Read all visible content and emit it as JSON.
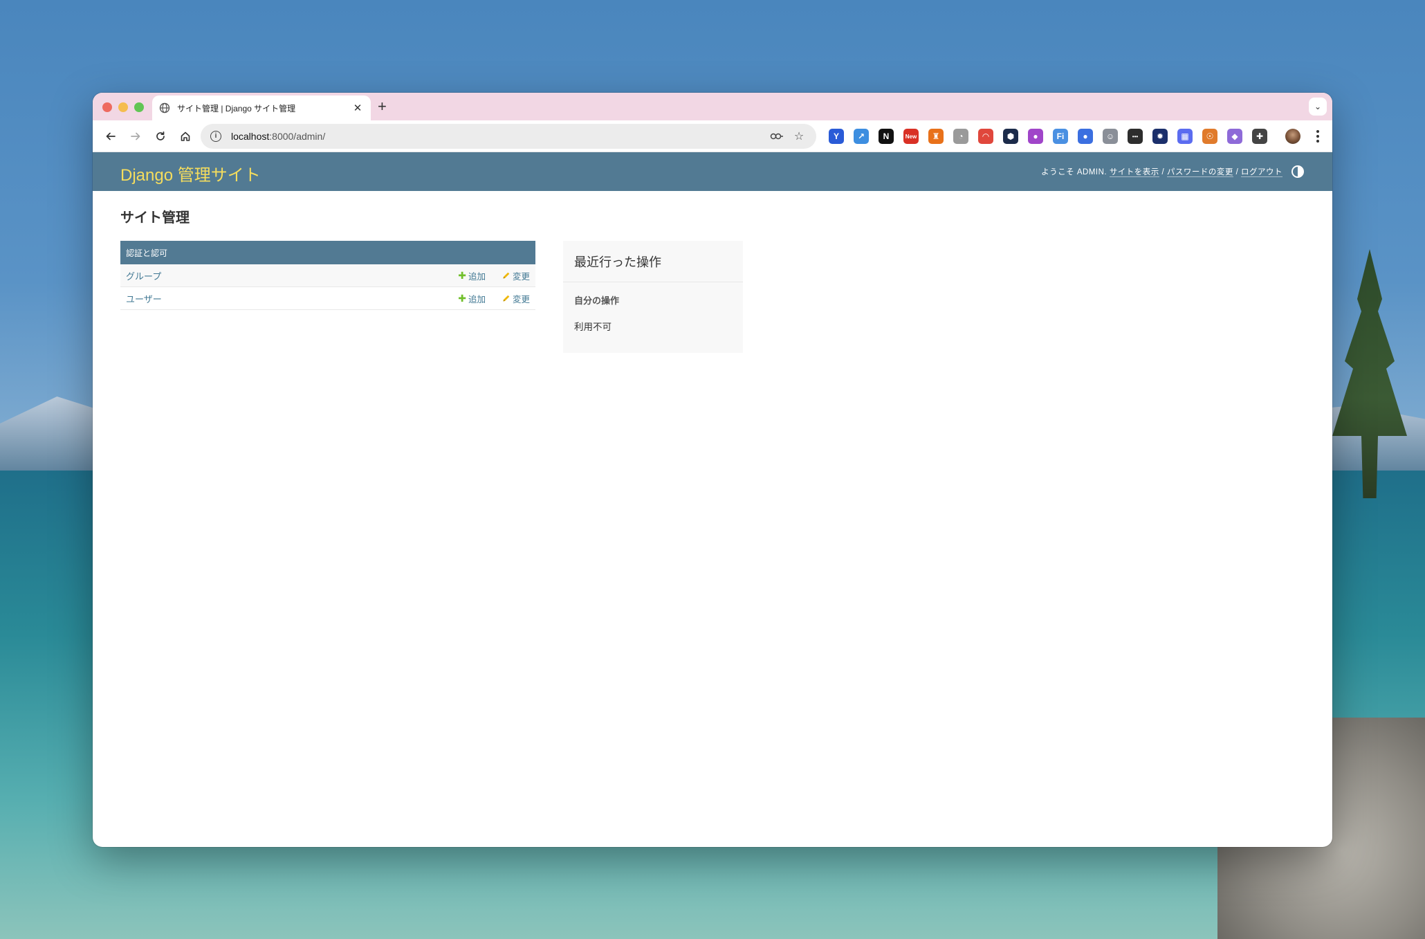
{
  "browser": {
    "tab_title": "サイト管理 | Django サイト管理",
    "new_tab_label": "+",
    "url_host": "localhost",
    "url_path": ":8000/admin/",
    "extensions": [
      {
        "icon": "v-logo-icon",
        "color": "#2a5bd7",
        "glyph": "Y"
      },
      {
        "icon": "share-icon",
        "color": "#3d8ee0",
        "glyph": "↗"
      },
      {
        "icon": "notion-icon",
        "color": "#111111",
        "glyph": "N"
      },
      {
        "icon": "new-badge-icon",
        "color": "#d93025",
        "glyph": "New"
      },
      {
        "icon": "fox-icon",
        "color": "#e8711a",
        "glyph": "♜"
      },
      {
        "icon": "rss-icon",
        "color": "#9a9a9a",
        "glyph": "◔"
      },
      {
        "icon": "red-swirl-icon",
        "color": "#e0473c",
        "glyph": "◠"
      },
      {
        "icon": "hexagon-icon",
        "color": "#1c2b4a",
        "glyph": "⬢"
      },
      {
        "icon": "purple-square-icon",
        "color": "#a045c9",
        "glyph": "●"
      },
      {
        "icon": "fi-icon",
        "color": "#4a90e2",
        "glyph": "Fi"
      },
      {
        "icon": "blue-dot-icon",
        "color": "#3b6fe0",
        "glyph": "●"
      },
      {
        "icon": "robot-icon",
        "color": "#8a8f98",
        "glyph": "☺"
      },
      {
        "icon": "dots-square-icon",
        "color": "#2d2d2d",
        "glyph": "•••"
      },
      {
        "icon": "sunburst-icon",
        "color": "#1b2f6b",
        "glyph": "✹"
      },
      {
        "icon": "grid-icon",
        "color": "#5b6cf0",
        "glyph": "▦"
      },
      {
        "icon": "snail-icon",
        "color": "#e07b2c",
        "glyph": "☉"
      },
      {
        "icon": "crystal-icon",
        "color": "#8e6ad8",
        "glyph": "◆"
      },
      {
        "icon": "puzzle-icon",
        "color": "#444444",
        "glyph": "✚"
      }
    ]
  },
  "admin": {
    "brand": "Django 管理サイト",
    "user_tools": {
      "welcome": "ようこそ ADMIN.",
      "view_site": "サイトを表示",
      "sep1": " / ",
      "change_password": "パスワードの変更",
      "sep2": " / ",
      "logout": "ログアウト"
    },
    "page_title": "サイト管理",
    "module": {
      "caption": "認証と認可",
      "rows": [
        {
          "name": "グループ",
          "add": "追加",
          "change": "変更"
        },
        {
          "name": "ユーザー",
          "add": "追加",
          "change": "変更"
        }
      ]
    },
    "recent": {
      "title": "最近行った操作",
      "subtitle": "自分の操作",
      "empty": "利用不可"
    }
  },
  "colors": {
    "header": "#527a93",
    "brand": "#f5dd5d",
    "link": "#417893",
    "add_icon": "#70bf2b",
    "tabstrip": "#f2d7e4"
  }
}
